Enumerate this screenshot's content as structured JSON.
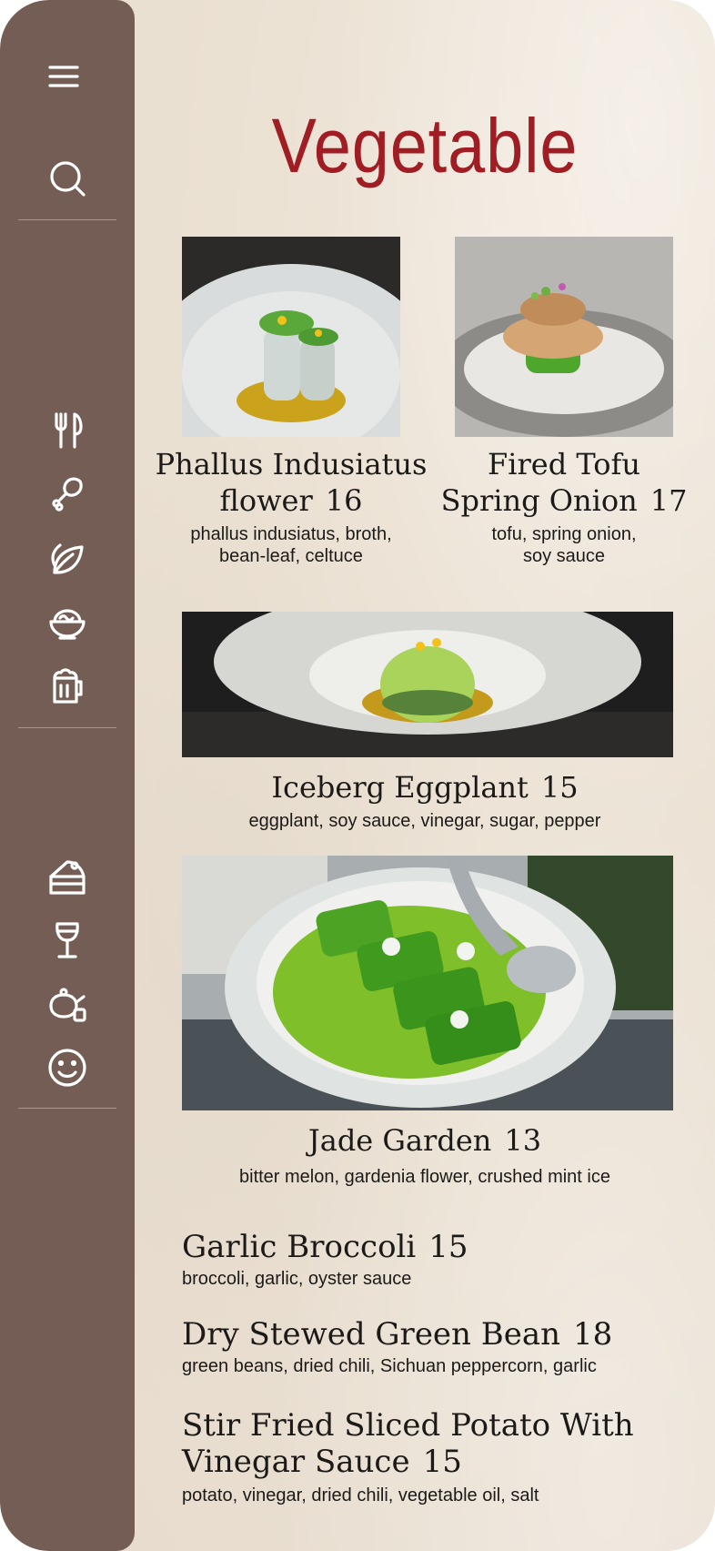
{
  "colors": {
    "sidebar": "#735d54",
    "title": "#a01d24",
    "background": "#ebe1d3",
    "text": "#1c1a18"
  },
  "sidebar": {
    "icons": [
      "menu-icon",
      "search-icon",
      "utensils-icon",
      "drumstick-icon",
      "leaf-icon",
      "noodle-bowl-icon",
      "beer-mug-icon",
      "cake-icon",
      "wine-glass-icon",
      "teapot-icon",
      "smiley-icon"
    ]
  },
  "page": {
    "title": "Vegetable"
  },
  "featured": [
    {
      "name_line1": "Phallus Indusiatus",
      "name_line2": "flower",
      "price": "16",
      "desc_line1": "phallus indusiatus, broth,",
      "desc_line2": "bean-leaf, celtuce"
    },
    {
      "name_line1": "Fired Tofu",
      "name_line2": "Spring Onion",
      "price": "17",
      "desc_line1": "tofu, spring onion,",
      "desc_line2": "soy sauce"
    },
    {
      "name": "Iceberg Eggplant",
      "price": "15",
      "desc": "eggplant, soy sauce, vinegar, sugar, pepper"
    },
    {
      "name": "Jade Garden",
      "price": "13",
      "desc": "bitter melon,  gardenia flower,  crushed mint ice"
    }
  ],
  "list": [
    {
      "name": "Garlic Broccoli",
      "price": "15",
      "desc": "broccoli, garlic, oyster sauce"
    },
    {
      "name": "Dry Stewed Green Bean",
      "price": "18",
      "desc": "green beans, dried chili, Sichuan peppercorn, garlic"
    },
    {
      "name_line1": "Stir Fried Sliced Potato With",
      "name_line2": "Vinegar Sauce",
      "price": "15",
      "desc": "potato, vinegar, dried chili, vegetable oil, salt"
    }
  ]
}
